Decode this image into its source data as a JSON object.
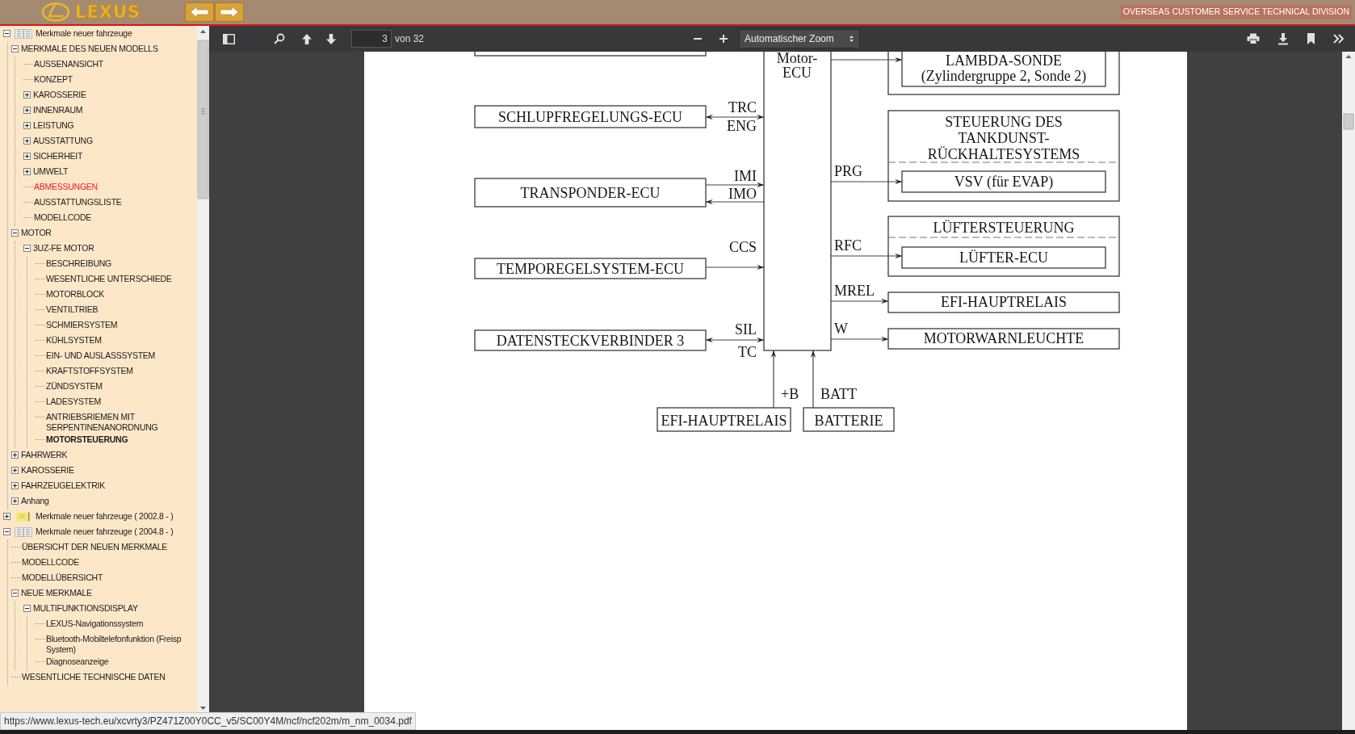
{
  "header": {
    "logo": "LEXUS",
    "division": "OVERSEAS CUSTOMER SERVICE TECHNICAL DIVISION"
  },
  "sidebar": {
    "tree": [
      {
        "label": "Merkmale neuer fahrzeuge",
        "kind": "book",
        "expanded": true,
        "selected": false,
        "visited": false,
        "children": [
          {
            "label": "MERKMALE DES NEUEN MODELLS",
            "expanded": true,
            "selected": false,
            "visited": false,
            "children": [
              {
                "label": "AUSSENANSICHT",
                "selected": false,
                "visited": false
              },
              {
                "label": "KONZEPT",
                "selected": false,
                "visited": false
              },
              {
                "label": "KAROSSERIE",
                "expanded": false,
                "selected": false,
                "visited": false
              },
              {
                "label": "INNENRAUM",
                "expanded": false,
                "selected": false,
                "visited": false
              },
              {
                "label": "LEISTUNG",
                "expanded": false,
                "selected": false,
                "visited": false
              },
              {
                "label": "AUSSTATTUNG",
                "expanded": false,
                "selected": false,
                "visited": false
              },
              {
                "label": "SICHERHEIT",
                "expanded": false,
                "selected": false,
                "visited": false
              },
              {
                "label": "UMWELT",
                "expanded": false,
                "selected": false,
                "visited": false
              },
              {
                "label": "ABMESSUNGEN",
                "selected": false,
                "visited": true
              },
              {
                "label": "AUSSTATTUNGSLISTE",
                "selected": false,
                "visited": false
              },
              {
                "label": "MODELLCODE",
                "selected": false,
                "visited": false
              }
            ]
          },
          {
            "label": "MOTOR",
            "expanded": true,
            "selected": false,
            "visited": false,
            "children": [
              {
                "label": "3UZ-FE MOTOR",
                "expanded": true,
                "selected": false,
                "visited": false,
                "children": [
                  {
                    "label": "BESCHREIBUNG",
                    "selected": false,
                    "visited": false
                  },
                  {
                    "label": "WESENTLICHE UNTERSCHIEDE",
                    "selected": false,
                    "visited": false
                  },
                  {
                    "label": "MOTORBLOCK",
                    "selected": false,
                    "visited": false
                  },
                  {
                    "label": "VENTILTRIEB",
                    "selected": false,
                    "visited": false
                  },
                  {
                    "label": "SCHMIERSYSTEM",
                    "selected": false,
                    "visited": false
                  },
                  {
                    "label": "KÜHLSYSTEM",
                    "selected": false,
                    "visited": false
                  },
                  {
                    "label": "EIN- UND AUSLASSSYSTEM",
                    "selected": false,
                    "visited": false
                  },
                  {
                    "label": "KRAFTSTOFFSYSTEM",
                    "selected": false,
                    "visited": false
                  },
                  {
                    "label": "ZÜNDSYSTEM",
                    "selected": false,
                    "visited": false
                  },
                  {
                    "label": "LADESYSTEM",
                    "selected": false,
                    "visited": false
                  },
                  {
                    "label": "ANTRIEBSRIEMEN MIT\nSERPENTINENANORDNUNG",
                    "selected": false,
                    "visited": false
                  },
                  {
                    "label": "MOTORSTEUERUNG",
                    "selected": true,
                    "visited": false
                  }
                ]
              }
            ]
          },
          {
            "label": "FAHRWERK",
            "expanded": false,
            "selected": false,
            "visited": false
          },
          {
            "label": "KAROSSERIE",
            "expanded": false,
            "selected": false,
            "visited": false
          },
          {
            "label": "FAHRZEUGELEKTRIK",
            "expanded": false,
            "selected": false,
            "visited": false
          },
          {
            "label": "Anhang",
            "expanded": false,
            "selected": false,
            "visited": false
          }
        ]
      },
      {
        "label": "Merkmale neuer fahrzeuge ( 2002.8 - )",
        "kind": "closed-book",
        "expanded": false,
        "selected": false,
        "visited": false
      },
      {
        "label": "Merkmale neuer fahrzeuge ( 2004.8 - )",
        "kind": "book",
        "expanded": true,
        "selected": false,
        "visited": false,
        "children": [
          {
            "label": "ÜBERSICHT DER NEUEN MERKMALE",
            "selected": false,
            "visited": false
          },
          {
            "label": "MODELLCODE",
            "selected": false,
            "visited": false
          },
          {
            "label": "MODELLÜBERSICHT",
            "selected": false,
            "visited": false
          },
          {
            "label": "NEUE MERKMALE",
            "expanded": true,
            "selected": false,
            "visited": false,
            "children": [
              {
                "label": "MULTIFUNKTIONSDISPLAY",
                "expanded": true,
                "selected": false,
                "visited": false,
                "children": [
                  {
                    "label": "LEXUS-Navigationssystem",
                    "selected": false,
                    "visited": false
                  },
                  {
                    "label": "Bluetooth-Mobiltelefonfunktion (Freisp\nSystem)",
                    "selected": false,
                    "visited": false
                  },
                  {
                    "label": "Diagnoseanzeige",
                    "selected": false,
                    "visited": false
                  }
                ]
              }
            ]
          },
          {
            "label": "WESENTLICHE TECHNISCHE DATEN",
            "selected": false,
            "visited": false
          }
        ]
      }
    ]
  },
  "toolbar": {
    "page": "3",
    "page_count": "von 32",
    "zoom": "Automatischer Zoom"
  },
  "diagram": {
    "ecu": [
      "Motor-",
      "ECU"
    ],
    "inputs": [
      {
        "kind": "bidirectional",
        "device": "SCHLUPFREGELUNGS-ECU",
        "signals": [
          "TRC",
          "ENG"
        ]
      },
      {
        "kind": "in_out",
        "device": "TRANSPONDER-ECU",
        "signals": [
          "IMI",
          "IMO"
        ]
      },
      {
        "kind": "input",
        "device": "TEMPOREGELSYSTEM-ECU",
        "signals": [
          "CCS"
        ]
      },
      {
        "kind": "bidirectional",
        "device": "DATENSTECKVERBINDER 3",
        "signals": [
          "SIL",
          "TC"
        ]
      }
    ],
    "outputs": [
      {
        "kind": "group",
        "device": [
          "LAMBDA-SONDE",
          "(Zylindergruppe 2, Sonde 2)"
        ]
      },
      {
        "kind": "group",
        "title": [
          "STEUERUNG DES",
          "TANKDUNST-",
          "RÜCKHALTESYSTEMS"
        ],
        "device": [
          "VSV (für EVAP)"
        ],
        "signal": "PRG"
      },
      {
        "kind": "group",
        "title": [
          "LÜFTERSTEUERUNG"
        ],
        "device": [
          "LÜFTER-ECU"
        ],
        "signal": "RFC"
      },
      {
        "kind": "box",
        "device": [
          "EFI-HAUPTRELAIS"
        ],
        "signal": "MREL"
      },
      {
        "kind": "box",
        "device": [
          "MOTORWARNLEUCHTE"
        ],
        "signal": "W"
      }
    ],
    "supplies": [
      {
        "device": "EFI-HAUPTRELAIS",
        "signal": "+B"
      },
      {
        "device": "BATTERIE",
        "signal": "BATT"
      }
    ]
  },
  "status_bar": {
    "url": "https://www.lexus-tech.eu/xcvrty3/PZ471Z00Y0CC_v5/SC00Y4M/ncf/ncf202m/m_nm_0034.pdf"
  }
}
